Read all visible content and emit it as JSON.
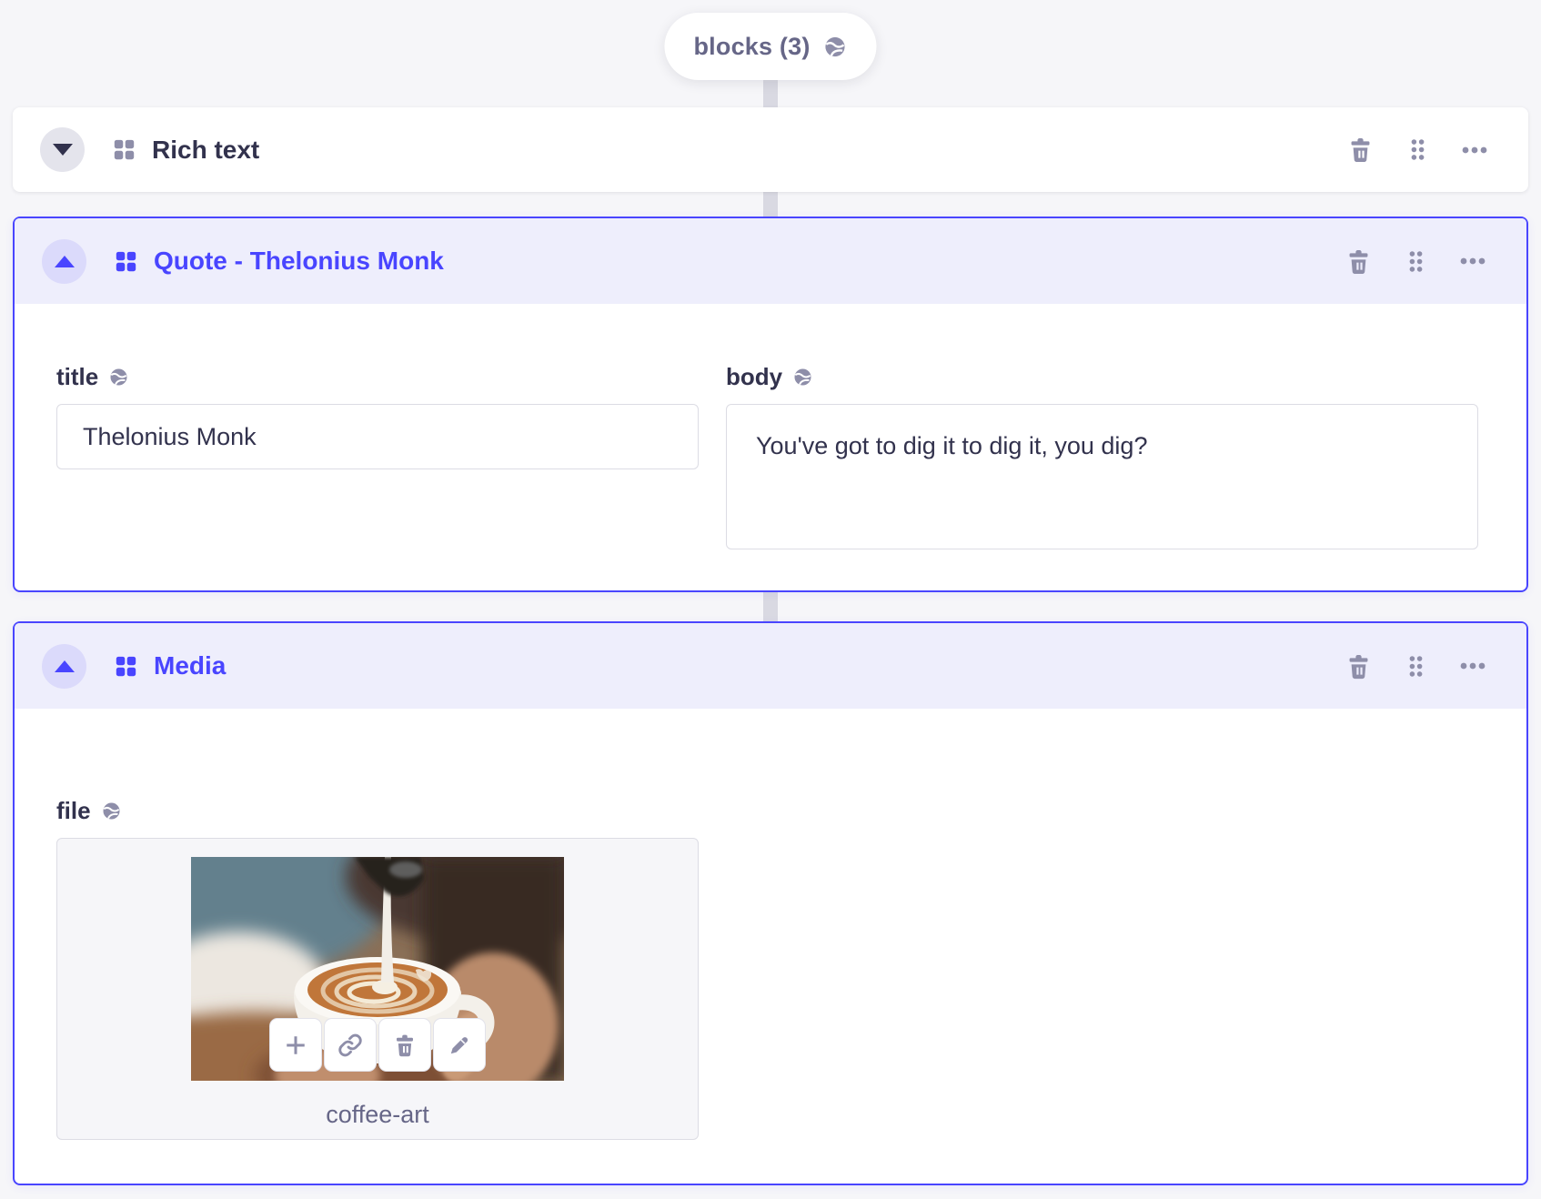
{
  "colors": {
    "accent": "#4945ff",
    "page_background": "#f6f6f9",
    "expanded_header_background": "#eeeefc",
    "icon_slate": "#8e8ea9",
    "text_dark": "#32324d",
    "text_muted": "#666687",
    "border": "#dcdce4"
  },
  "zone_pill": {
    "label": "blocks (3)",
    "icon": "globe-icon"
  },
  "header_action_icons": [
    "trash-icon",
    "drag-handle-icon",
    "more-options-icon"
  ],
  "blocks": [
    {
      "label": "Rich text",
      "state": "collapsed",
      "toggle_icon": "caret-down",
      "type_icon": "blocks-icon"
    },
    {
      "label": "Quote - Thelonius Monk",
      "state": "expanded",
      "toggle_icon": "caret-up",
      "type_icon": "blocks-icon",
      "fields": {
        "title": {
          "label": "title",
          "localized_icon": "globe-icon",
          "value": "Thelonius Monk"
        },
        "body": {
          "label": "body",
          "localized_icon": "globe-icon",
          "value": "You've got to dig it to dig it, you dig?"
        }
      }
    },
    {
      "label": "Media",
      "state": "expanded",
      "toggle_icon": "caret-up",
      "type_icon": "blocks-icon",
      "fields": {
        "file": {
          "label": "file",
          "localized_icon": "globe-icon",
          "filename": "coffee-art",
          "preview": "latte-art-coffee-photo",
          "action_icons": [
            "plus-icon",
            "link-icon",
            "trash-icon",
            "pencil-icon"
          ]
        }
      }
    }
  ]
}
